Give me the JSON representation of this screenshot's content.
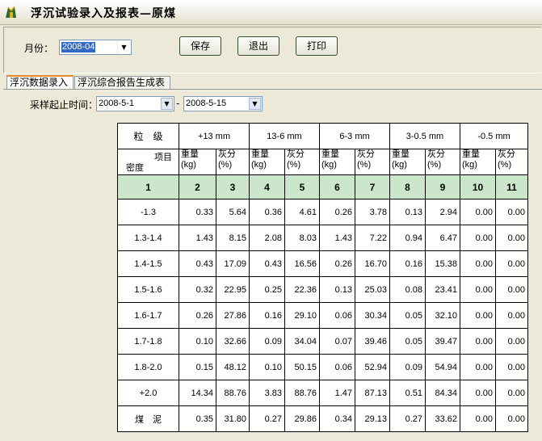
{
  "window": {
    "title": "浮沉试验录入及报表—原煤"
  },
  "form": {
    "month_label": "月份：",
    "month_value": "2008-04",
    "save_label": "保存",
    "exit_label": "退出",
    "print_label": "打印"
  },
  "tabs": [
    {
      "label": "浮沉数据录入",
      "active": true
    },
    {
      "label": "浮沉综合报告生成表",
      "active": false
    }
  ],
  "sampling": {
    "label": "采样起止时间：",
    "start": "2008-5-1",
    "separator": "-",
    "end": "2008-5-15"
  },
  "table": {
    "size_label": "粒　级",
    "item_label": "项目",
    "density_label": "密度",
    "size_classes": [
      "+13 mm",
      "13-6 mm",
      "6-3 mm",
      "3-0.5 mm",
      "-0.5 mm"
    ],
    "weight_label": "重量",
    "weight_unit": "(kg)",
    "ash_label": "灰分",
    "ash_unit": "(%)",
    "col_numbers": [
      "1",
      "2",
      "3",
      "4",
      "5",
      "6",
      "7",
      "8",
      "9",
      "10",
      "11"
    ],
    "header_color": "#cbe6cb",
    "rows": [
      {
        "density": "-1.3",
        "values": [
          "0.33",
          "5.64",
          "0.36",
          "4.61",
          "0.26",
          "3.78",
          "0.13",
          "2.94",
          "0.00",
          "0.00"
        ]
      },
      {
        "density": "1.3-1.4",
        "values": [
          "1.43",
          "8.15",
          "2.08",
          "8.03",
          "1.43",
          "7.22",
          "0.94",
          "6.47",
          "0.00",
          "0.00"
        ]
      },
      {
        "density": "1.4-1.5",
        "values": [
          "0.43",
          "17.09",
          "0.43",
          "16.56",
          "0.26",
          "16.70",
          "0.16",
          "15.38",
          "0.00",
          "0.00"
        ]
      },
      {
        "density": "1.5-1.6",
        "values": [
          "0.32",
          "22.95",
          "0.25",
          "22.36",
          "0.13",
          "25.03",
          "0.08",
          "23.41",
          "0.00",
          "0.00"
        ]
      },
      {
        "density": "1.6-1.7",
        "values": [
          "0.26",
          "27.86",
          "0.16",
          "29.10",
          "0.06",
          "30.34",
          "0.05",
          "32.10",
          "0.00",
          "0.00"
        ]
      },
      {
        "density": "1.7-1.8",
        "values": [
          "0.10",
          "32.66",
          "0.09",
          "34.04",
          "0.07",
          "39.46",
          "0.05",
          "39.47",
          "0.00",
          "0.00"
        ]
      },
      {
        "density": "1.8-2.0",
        "values": [
          "0.15",
          "48.12",
          "0.10",
          "50.15",
          "0.06",
          "52.94",
          "0.09",
          "54.94",
          "0.00",
          "0.00"
        ]
      },
      {
        "density": "+2.0",
        "values": [
          "14.34",
          "88.76",
          "3.83",
          "88.76",
          "1.47",
          "87.13",
          "0.51",
          "84.34",
          "0.00",
          "0.00"
        ]
      },
      {
        "density": "煤　泥",
        "values": [
          "0.35",
          "31.80",
          "0.27",
          "29.86",
          "0.34",
          "29.13",
          "0.27",
          "33.62",
          "0.00",
          "0.00"
        ]
      }
    ]
  }
}
